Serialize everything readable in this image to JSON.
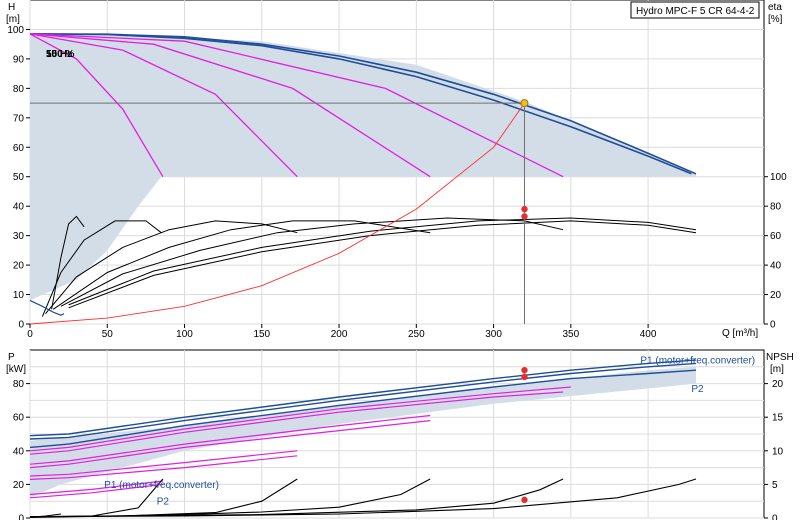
{
  "title": "Hydro MPC-F 5 CR 64-4-2",
  "colors": {
    "curve_blue": "#1f4e9a",
    "magenta": "#e020e0",
    "area_fill": "#d3dde8",
    "duty_point": "#e03030",
    "op_marker": "#f0c020",
    "system_curve": "#ff3030"
  },
  "chart_data": [
    {
      "type": "line",
      "name": "upper",
      "ylabel_left": [
        "H",
        "[m]"
      ],
      "ylabel_right": [
        "eta",
        "[%]"
      ],
      "xlabel": "Q [m³/h]",
      "curve_label": "150 %",
      "curve_label_overlap": "50 Hz",
      "xlim": [
        0,
        475
      ],
      "ylim": [
        0,
        110
      ],
      "x_ticks": [
        0,
        50,
        100,
        150,
        200,
        250,
        300,
        350,
        400
      ],
      "y_ticks_left": [
        0,
        10,
        20,
        30,
        40,
        50,
        60,
        70,
        80,
        90,
        100
      ],
      "y_ticks_right": [
        0,
        20,
        40,
        60,
        80,
        100
      ],
      "right_axis_range": [
        0,
        50
      ],
      "area_envelope": {
        "x": [
          0,
          60,
          150,
          250,
          320,
          350,
          400,
          431,
          431,
          85,
          70,
          50,
          30,
          0
        ],
        "y": [
          98.5,
          98.2,
          96,
          88,
          75.5,
          69,
          58,
          51,
          50,
          50,
          40,
          25,
          15,
          8
        ]
      },
      "hq_series": [
        {
          "x": [
            0,
            50,
            100,
            150,
            200,
            250,
            300,
            350,
            400,
            431
          ],
          "y": [
            98.5,
            98.4,
            97.5,
            95,
            91,
            85.5,
            78,
            69,
            58,
            51
          ],
          "style": "blue"
        },
        {
          "x": [
            0,
            50,
            100,
            150,
            200,
            250,
            300,
            350,
            400,
            428
          ],
          "y": [
            98.5,
            98.3,
            97,
            94.5,
            90,
            84,
            76,
            67,
            57,
            51
          ],
          "style": "blue"
        },
        {
          "x": [
            0,
            30,
            60,
            86
          ],
          "y": [
            98.5,
            90,
            73,
            50
          ],
          "style": "magenta"
        },
        {
          "x": [
            0,
            60,
            120,
            173
          ],
          "y": [
            98.5,
            93,
            78,
            50
          ],
          "style": "magenta"
        },
        {
          "x": [
            0,
            80,
            170,
            259
          ],
          "y": [
            98.5,
            95,
            80,
            50
          ],
          "style": "magenta"
        },
        {
          "x": [
            0,
            100,
            230,
            345
          ],
          "y": [
            98.5,
            96,
            80,
            50
          ],
          "style": "magenta"
        }
      ],
      "eta_series": [
        {
          "x": [
            14,
            20,
            25,
            30,
            35
          ],
          "y": [
            10,
            45,
            68,
            73,
            66
          ]
        },
        {
          "x": [
            8,
            20,
            35,
            55,
            75,
            85
          ],
          "y": [
            5,
            35,
            57,
            70,
            70,
            62
          ]
        },
        {
          "x": [
            10,
            30,
            60,
            90,
            120,
            150,
            173
          ],
          "y": [
            7,
            32,
            52,
            64,
            70,
            68,
            62
          ]
        },
        {
          "x": [
            15,
            50,
            90,
            130,
            170,
            210,
            259
          ],
          "y": [
            10,
            35,
            52,
            64,
            70,
            70,
            62
          ]
        },
        {
          "x": [
            20,
            60,
            110,
            160,
            210,
            270,
            320,
            345
          ],
          "y": [
            12,
            34,
            50,
            62,
            68,
            72,
            70,
            64
          ]
        },
        {
          "x": [
            25,
            80,
            150,
            220,
            290,
            350,
            400,
            431
          ],
          "y": [
            13,
            36,
            52,
            63,
            70,
            72,
            69,
            64
          ]
        },
        {
          "x": [
            25,
            80,
            150,
            220,
            290,
            350,
            400,
            431
          ],
          "y": [
            11,
            33,
            49,
            60,
            67,
            70,
            67,
            62
          ]
        }
      ],
      "npsh_low": {
        "x": [
          0,
          8,
          15,
          20,
          22
        ],
        "y": [
          8,
          6,
          4,
          3,
          3.5
        ]
      },
      "system_curve": {
        "x": [
          0,
          50,
          100,
          150,
          200,
          250,
          300,
          320
        ],
        "y": [
          0,
          2,
          6,
          13,
          24,
          39,
          60,
          75
        ]
      },
      "duty_point": {
        "x": 320,
        "y": 75
      },
      "eta_markers": [
        {
          "x": 320,
          "y": 78
        },
        {
          "x": 320,
          "y": 73
        }
      ]
    },
    {
      "type": "line",
      "name": "lower",
      "ylabel_left": [
        "P",
        "[kW]"
      ],
      "ylabel_right": [
        "NPSH",
        "[m]"
      ],
      "xlim": [
        0,
        475
      ],
      "ylim": [
        0,
        100
      ],
      "y_ticks_left": [
        0,
        20,
        40,
        60,
        80
      ],
      "y_ticks_right": [
        0,
        5,
        10,
        15,
        20
      ],
      "right_axis_range": [
        0,
        25
      ],
      "labels": [
        {
          "text": "P1 (motor+freq.converter)",
          "x": 395,
          "y": 92,
          "color": "blue"
        },
        {
          "text": "P2",
          "x": 428,
          "y": 75,
          "color": "blue"
        },
        {
          "text": "P1 (motor+freq.converter)",
          "x": 48,
          "y": 18,
          "color": "blue"
        },
        {
          "text": "P2",
          "x": 82,
          "y": 8,
          "color": "blue"
        }
      ],
      "area_envelope": {
        "x": [
          0,
          100,
          200,
          300,
          400,
          431,
          431,
          300,
          200,
          100,
          20,
          0
        ],
        "y": [
          46,
          55,
          67,
          78,
          88,
          90,
          80,
          68,
          56,
          40,
          20,
          12
        ]
      },
      "p_series": [
        {
          "x": [
            0,
            25,
            100,
            200,
            300,
            350,
            400,
            431
          ],
          "y": [
            49,
            50,
            60,
            72,
            83,
            88,
            92,
            94
          ],
          "style": "blue"
        },
        {
          "x": [
            0,
            25,
            100,
            200,
            300,
            350,
            400,
            431
          ],
          "y": [
            47,
            48,
            58,
            70,
            81,
            86,
            90,
            92
          ],
          "style": "blue"
        },
        {
          "x": [
            0,
            25,
            100,
            200,
            300,
            350,
            400,
            431
          ],
          "y": [
            42,
            44,
            55,
            67,
            78,
            83,
            86,
            88
          ],
          "style": "blue"
        },
        {
          "x": [
            0,
            25,
            100,
            200,
            300,
            350
          ],
          "y": [
            40,
            42,
            53,
            65,
            74,
            78
          ],
          "style": "magenta"
        },
        {
          "x": [
            0,
            25,
            100,
            200,
            300,
            345
          ],
          "y": [
            38,
            40,
            51,
            63,
            72,
            75
          ],
          "style": "magenta"
        },
        {
          "x": [
            0,
            25,
            100,
            200,
            259
          ],
          "y": [
            32,
            34,
            44,
            55,
            61
          ],
          "style": "magenta"
        },
        {
          "x": [
            0,
            25,
            100,
            200,
            259
          ],
          "y": [
            30,
            32,
            42,
            52,
            58
          ],
          "style": "magenta"
        },
        {
          "x": [
            0,
            25,
            100,
            173
          ],
          "y": [
            25,
            26,
            33,
            40
          ],
          "style": "magenta"
        },
        {
          "x": [
            0,
            25,
            100,
            173
          ],
          "y": [
            23,
            24,
            30,
            37
          ],
          "style": "magenta"
        },
        {
          "x": [
            0,
            40,
            86
          ],
          "y": [
            14,
            17,
            22
          ],
          "style": "magenta"
        },
        {
          "x": [
            0,
            40,
            86
          ],
          "y": [
            12,
            15,
            20
          ],
          "style": "magenta"
        }
      ],
      "npsh_series": [
        {
          "x": [
            0,
            50,
            100,
            150,
            200,
            240,
            259
          ],
          "y": [
            0.2,
            0.3,
            0.5,
            0.9,
            1.6,
            3.5,
            5.8
          ]
        },
        {
          "x": [
            0,
            50,
            150,
            250,
            300,
            330,
            345
          ],
          "y": [
            0.2,
            0.3,
            0.5,
            1.2,
            2.2,
            4.2,
            5.8
          ]
        },
        {
          "x": [
            0,
            100,
            200,
            300,
            380,
            420,
            431
          ],
          "y": [
            0.2,
            0.3,
            0.6,
            1.4,
            3.0,
            5.0,
            5.8
          ]
        },
        {
          "x": [
            0,
            60,
            120,
            150,
            173
          ],
          "y": [
            0.1,
            0.3,
            0.8,
            2.5,
            5.8
          ]
        },
        {
          "x": [
            0,
            40,
            70,
            86
          ],
          "y": [
            0.1,
            0.3,
            1.5,
            5.8
          ]
        },
        {
          "x": [
            0,
            10,
            20
          ],
          "y": [
            0.1,
            0.3,
            0.6
          ]
        }
      ],
      "markers_p": [
        {
          "x": 320,
          "y": 88
        },
        {
          "x": 320,
          "y": 84
        }
      ],
      "marker_npsh": {
        "x": 320,
        "y": 2.7
      }
    }
  ]
}
